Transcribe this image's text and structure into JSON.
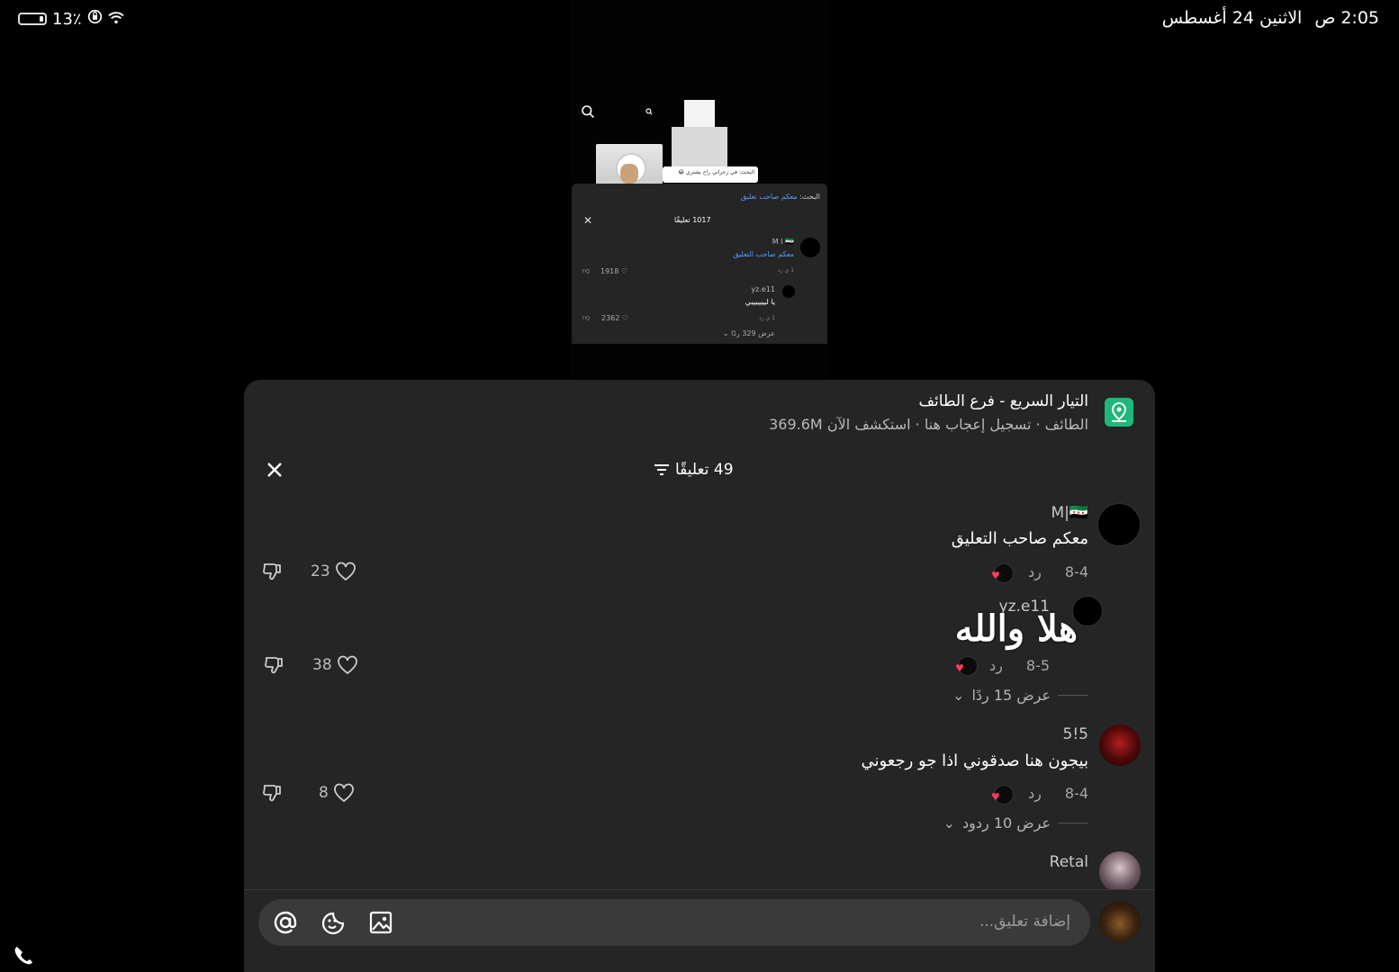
{
  "status": {
    "battery": "13٪",
    "time": "2:05 ص",
    "date": "الاثنين 24 أغسطس"
  },
  "background_post": {
    "bubble_text": "البحث: في زعراني راح يشتري 😂",
    "search_label": "البحث:",
    "search_term": "معكم صاحب تعليق",
    "comment_count": "1017 تعليقًا",
    "c1_name": "M I 🇸🇾",
    "c1_text": "معكم صاحب التعليق",
    "c1_likes": "1918",
    "c1_meta": "1 ي   رد",
    "c2_name": "yz.e11",
    "c2_text": "يا ليييييييي",
    "c2_likes": "2362",
    "c2_meta": "1 ي   رد",
    "c2_replies": "عرض 329 ردًا"
  },
  "promo": {
    "title": "التيار السريع - فرع الطائف",
    "subtitle": "الطائف · تسجيل إعجاب هنا · استكشف الآن 369.6M"
  },
  "header": {
    "comment_count": "49 تعليقًا"
  },
  "comments": [
    {
      "name": "M|🇸🇾",
      "text": "معكم صاحب التعليق",
      "date": "8-4",
      "reply": "رد",
      "likes": "23"
    },
    {
      "name": "yz.e11",
      "text": "هلا والله",
      "date": "8-5",
      "reply": "رد",
      "likes": "38",
      "replies": "عرض 15 ردًا"
    },
    {
      "name": "5!5",
      "text": "بيجون هنا صدقوني اذا جو رجعوني",
      "date": "8-4",
      "reply": "رد",
      "likes": "8",
      "replies": "عرض 10 ردود"
    },
    {
      "name": "Retal",
      "text": "..."
    }
  ],
  "composer": {
    "placeholder": "إضافة تعليق..."
  },
  "colors": {
    "sheet_bg": "#252525",
    "promo_icon": "#1fb77a",
    "heart": "#ff3b5c"
  }
}
